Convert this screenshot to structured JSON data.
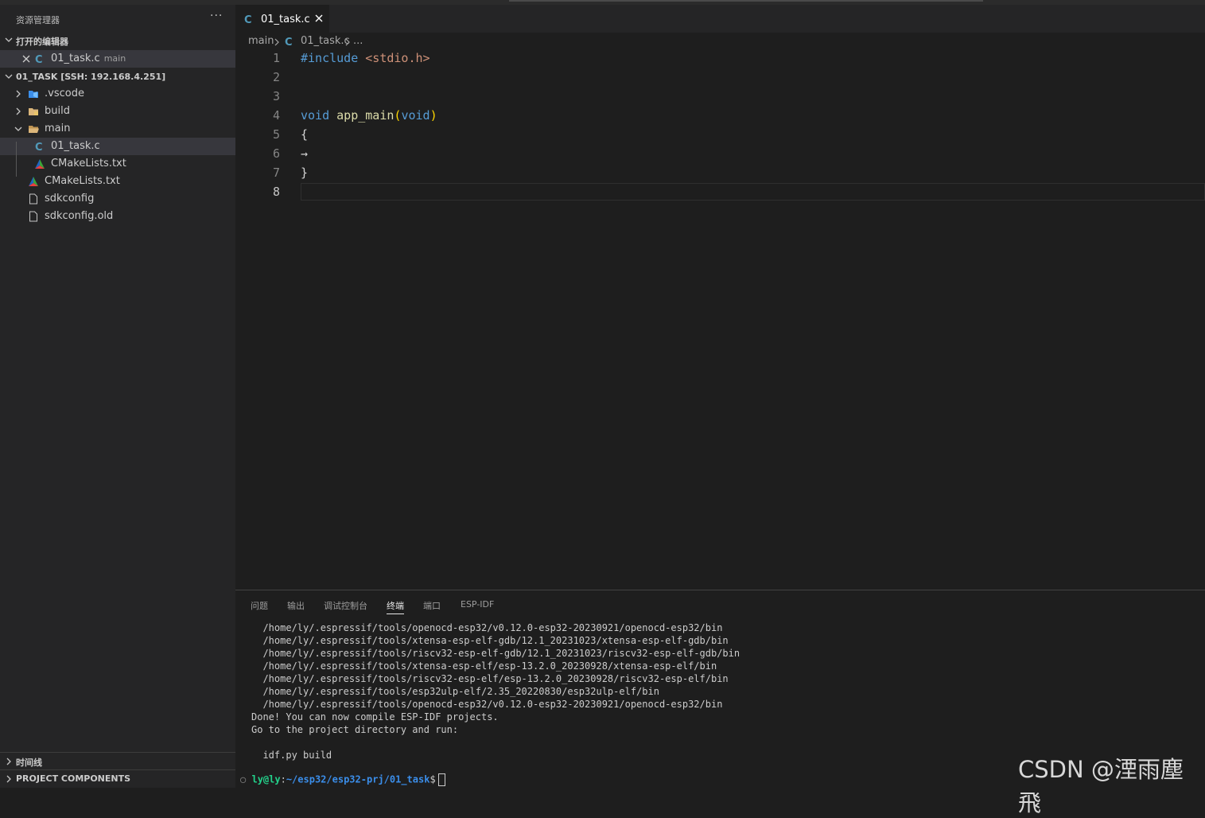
{
  "explorer": {
    "title": "资源管理器",
    "more": "···",
    "open_editors": {
      "label": "打开的编辑器",
      "items": [
        {
          "name": "01_task.c",
          "desc": "main"
        }
      ]
    },
    "workspace": {
      "label": "01_TASK [SSH: 192.168.4.251]",
      "items": [
        {
          "name": ".vscode"
        },
        {
          "name": "build"
        },
        {
          "name": "main"
        },
        {
          "name": "01_task.c"
        },
        {
          "name": "CMakeLists.txt"
        },
        {
          "name": "CMakeLists.txt"
        },
        {
          "name": "sdkconfig"
        },
        {
          "name": "sdkconfig.old"
        }
      ]
    },
    "bottom_sections": [
      "时间线",
      "PROJECT COMPONENTS"
    ]
  },
  "tab": {
    "label": "01_task.c"
  },
  "breadcrumb": [
    "main",
    "01_task.c",
    "..."
  ],
  "editor": {
    "lines": [
      {
        "num": "1",
        "a": "#include",
        "b": " ",
        "c": "<stdio.h>"
      },
      {
        "num": "2"
      },
      {
        "num": "3"
      },
      {
        "num": "4",
        "a": "void",
        "b": " ",
        "c": "app_main",
        "d": "(",
        "e": "void",
        "f": ")"
      },
      {
        "num": "5",
        "a": "{"
      },
      {
        "num": "6",
        "a": "→"
      },
      {
        "num": "7",
        "a": "}"
      },
      {
        "num": "8"
      }
    ]
  },
  "panel": {
    "tabs": [
      "问题",
      "输出",
      "调试控制台",
      "终端",
      "端口",
      "ESP-IDF"
    ],
    "active_tab": "终端",
    "terminal_lines": [
      "  /home/ly/.espressif/tools/openocd-esp32/v0.12.0-esp32-20230921/openocd-esp32/bin",
      "  /home/ly/.espressif/tools/xtensa-esp-elf-gdb/12.1_20231023/xtensa-esp-elf-gdb/bin",
      "  /home/ly/.espressif/tools/riscv32-esp-elf-gdb/12.1_20231023/riscv32-esp-elf-gdb/bin",
      "  /home/ly/.espressif/tools/xtensa-esp-elf/esp-13.2.0_20230928/xtensa-esp-elf/bin",
      "  /home/ly/.espressif/tools/riscv32-esp-elf/esp-13.2.0_20230928/riscv32-esp-elf/bin",
      "  /home/ly/.espressif/tools/esp32ulp-elf/2.35_20220830/esp32ulp-elf/bin",
      "  /home/ly/.espressif/tools/openocd-esp32/v0.12.0-esp32-20230921/openocd-esp32/bin",
      "Done! You can now compile ESP-IDF projects.",
      "Go to the project directory and run:",
      "",
      "  idf.py build"
    ],
    "prompt": {
      "dot": "○",
      "user": "ly@ly",
      "sep": ":",
      "path": "~/esp32/esp32-prj/01_task",
      "dollar": "$"
    }
  },
  "watermark": "CSDN @湮雨塵飛",
  "colors": {
    "c_icon": "#519aba",
    "folder": "#dcb67a",
    "vscode_folder": "#3b8eea"
  }
}
